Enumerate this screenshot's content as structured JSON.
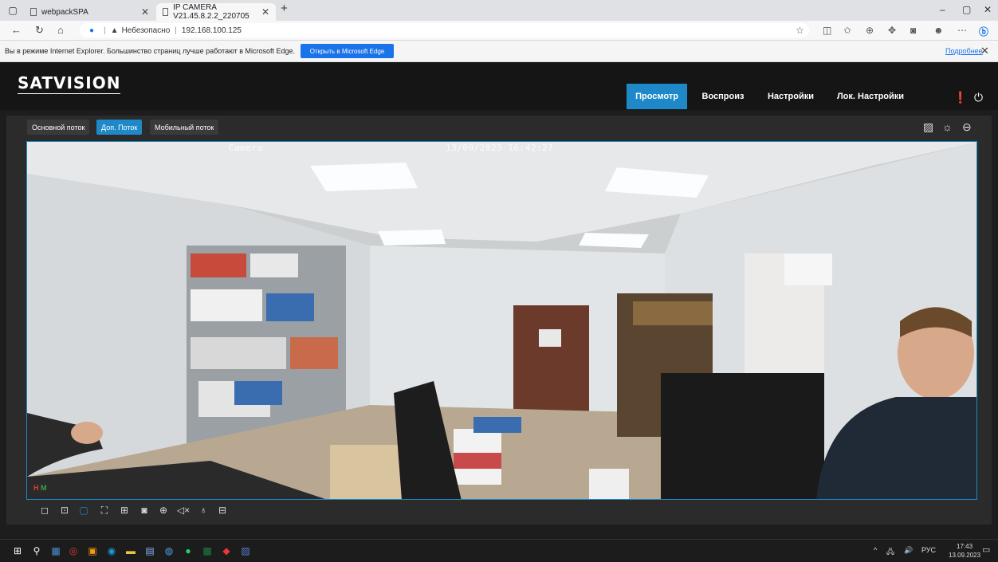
{
  "browser": {
    "tabs": [
      {
        "label": "webpackSPA",
        "active": false
      },
      {
        "label": "IP CAMERA V21.45.8.2.2_220705",
        "active": true
      }
    ],
    "new_tab": "+",
    "window_controls": {
      "minimize": "–",
      "restore": "▢",
      "close": "✕"
    },
    "address": {
      "security_label": "Небезопасно",
      "url": "192.168.100.125"
    },
    "infobar": {
      "message": "Вы в режиме Internet Explorer. Большинство страниц лучше работают в Microsoft Edge.",
      "open_button": "Открыть в Microsoft Edge",
      "more_link": "Подробнее",
      "close": "✕"
    }
  },
  "app": {
    "logo": "SATVISION",
    "menu": [
      {
        "label": "Просмотр",
        "active": true
      },
      {
        "label": "Воспроиз",
        "active": false
      },
      {
        "label": "Настройки",
        "active": false
      },
      {
        "label": "Лок. Настройки",
        "active": false
      }
    ],
    "streams": [
      {
        "label": "Основной поток",
        "active": false
      },
      {
        "label": "Доп. Поток",
        "active": true
      },
      {
        "label": "Мобильный поток",
        "active": false
      }
    ],
    "video": {
      "osd_name": "Camera",
      "osd_time": "13/09/2023 16:42:27",
      "indicator_h": "H",
      "indicator_m": "M"
    }
  },
  "taskbar": {
    "lang": "РУС",
    "time": "17:43",
    "date": "13.09.2023"
  },
  "colors": {
    "accent": "#1e88c8",
    "header_bg": "#151515",
    "panel_bg": "#2b2b2b"
  }
}
